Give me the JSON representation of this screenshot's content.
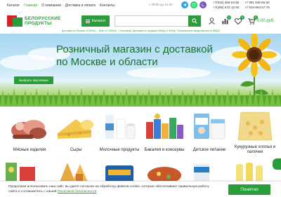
{
  "topnav": {
    "items": [
      "Каталог",
      "Главная",
      "О компании",
      "Доставка и оплата",
      "Контакты"
    ],
    "hours": "с 09:00 до 21:00"
  },
  "phones": {
    "left": [
      "+7(916) 360-54-55",
      "+7(495) 672-12-50"
    ],
    "right": [
      "+7 991 938-56-50",
      "+7 916-863-57-75"
    ]
  },
  "header": {
    "logo_line1": "БЕЛОРУССКИЕ",
    "logo_line2": "ПРОДУКТЫ",
    "catalog_label": "Каталог",
    "search_placeholder": "",
    "compare_count": "0",
    "favorites_count": "0",
    "cart_count": "0",
    "cart_total": "0.00 руб."
  },
  "notice": "Доставка по Москве от 5000р. – М4р. от 10000р. – Балашиха. Доставка по продажи МКАД от 6000р. Специальные предложения по МКАД",
  "hero": {
    "title_line1": "Розничный магазин с доставкой",
    "title_line2": "по Москве и области",
    "button_label": "Выбрать вкусняшки"
  },
  "categories": [
    {
      "label": "Мясные изделия"
    },
    {
      "label": "Сыры"
    },
    {
      "label": "Молочные продукты"
    },
    {
      "label": "Бакалея и консервы"
    },
    {
      "label": "Детское питание"
    },
    {
      "label": "Кукурузные хлопья и палочки"
    }
  ],
  "cookie": {
    "text": "Продолжая использовать наш сайт, вы даете согласие на обработку файлов cookie, которые обеспечивают правильную работу сайта и соглашаетесь с нашей",
    "link": "Политикой безопасности",
    "button": "Понятно"
  },
  "colors": {
    "brand_green": "#2a9d3a",
    "brand_red": "#d2232a",
    "whatsapp": "#25d366",
    "telegram": "#2ca5e0",
    "viber": "#7d54b8"
  }
}
